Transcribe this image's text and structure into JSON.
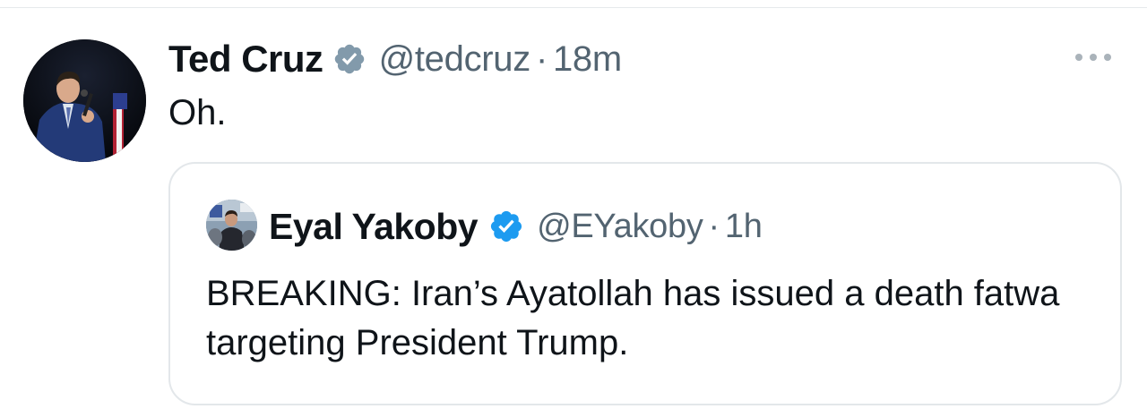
{
  "tweet": {
    "author": {
      "display_name": "Ted Cruz",
      "handle": "@tedcruz",
      "verified": true,
      "verified_color": "#829aab"
    },
    "separator": "·",
    "time": "18m",
    "text": "Oh.",
    "more_icon": "more-horizontal-icon"
  },
  "quoted_tweet": {
    "author": {
      "display_name": "Eyal Yakoby",
      "handle": "@EYakoby",
      "verified": true,
      "verified_color": "#1d9bf0"
    },
    "separator": "·",
    "time": "1h",
    "text": "BREAKING: Iran’s Ayatollah has issued a death fatwa targeting President Trump."
  },
  "colors": {
    "primary_text": "#0f1419",
    "secondary_text": "#536471",
    "border": "#e3e7ea",
    "background": "#ffffff"
  }
}
